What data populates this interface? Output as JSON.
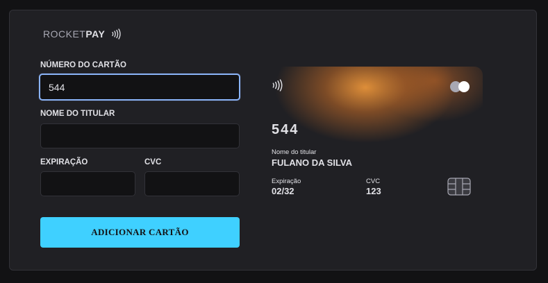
{
  "logo": {
    "part1": "ROCKET",
    "part2": "PAY"
  },
  "form": {
    "card_number_label": "NÚMERO DO CARTÃO",
    "card_number_value": "544",
    "holder_label": "NOME DO TITULAR",
    "holder_value": "",
    "expiration_label": "EXPIRAÇÃO",
    "expiration_value": "",
    "cvc_label": "CVC",
    "cvc_value": "",
    "submit_label": "ADICIONAR CARTÃO"
  },
  "card_preview": {
    "number": "544",
    "holder_caption": "Nome do titular",
    "holder_name": "FULANO DA SILVA",
    "expiration_caption": "Expiração",
    "expiration_value": "02/32",
    "cvc_caption": "CVC",
    "cvc_value": "123",
    "brand_icon": "card-brand-icon",
    "chip_icon": "chip-icon",
    "contactless_icon": "contactless-icon"
  },
  "colors": {
    "background": "#121214",
    "panel": "#202024",
    "accent": "#3fd0ff",
    "focus_border": "#8ab4f8",
    "card_glow": "#e8943a"
  }
}
